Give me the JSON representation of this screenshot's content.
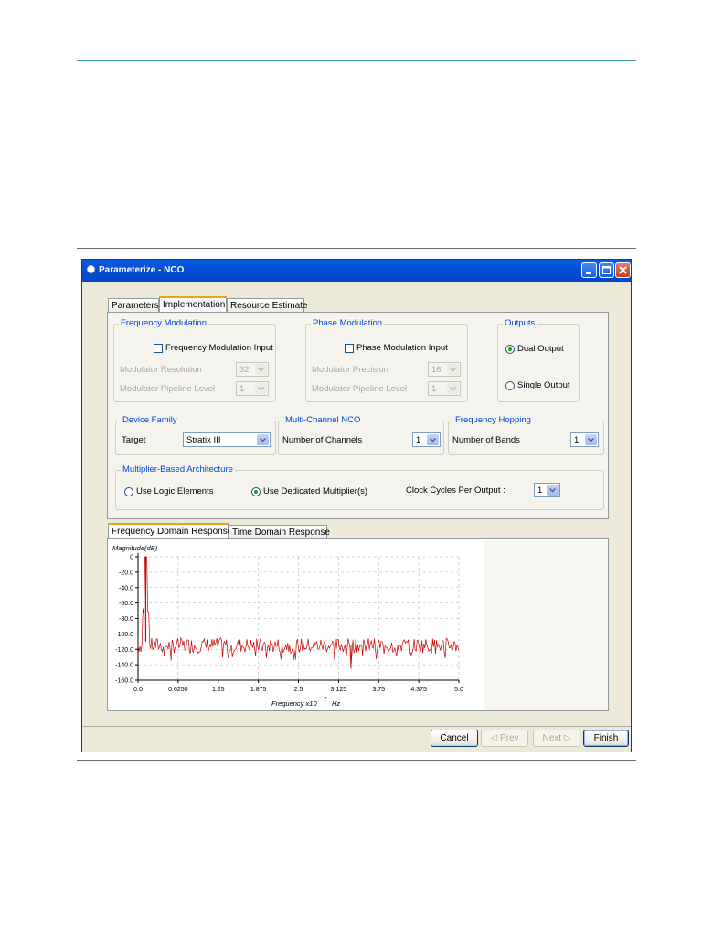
{
  "window": {
    "title": "Parameterize - NCO"
  },
  "tabs": {
    "parameters": "Parameters",
    "implementation": "Implementation",
    "resource": "Resource Estimate"
  },
  "freq_mod": {
    "legend": "Frequency Modulation",
    "input_label": "Frequency Modulation Input",
    "resolution_label": "Modulator Resolution",
    "resolution_value": "32",
    "pipeline_label": "Modulator Pipeline Level",
    "pipeline_value": "1"
  },
  "phase_mod": {
    "legend": "Phase Modulation",
    "input_label": "Phase Modulation Input",
    "precision_label": "Modulator Precision",
    "precision_value": "16",
    "pipeline_label": "Modulator Pipeline Level",
    "pipeline_value": "1"
  },
  "outputs": {
    "legend": "Outputs",
    "dual": "Dual Output",
    "single": "Single Output",
    "selected": "dual"
  },
  "device": {
    "legend": "Device Family",
    "target_label": "Target",
    "target_value": "Stratix III"
  },
  "multichannel": {
    "legend": "Multi-Channel NCO",
    "label": "Number of Channels",
    "value": "1"
  },
  "hopping": {
    "legend": "Frequency Hopping",
    "label": "Number of Bands",
    "value": "1"
  },
  "multiplier": {
    "legend": "Multiplier-Based Architecture",
    "logic": "Use Logic Elements",
    "dedicated": "Use Dedicated Multiplier(s)",
    "selected": "dedicated",
    "clock_label": "Clock Cycles Per Output :",
    "clock_value": "1"
  },
  "response_tabs": {
    "freq": "Frequency Domain Response",
    "time": "Time Domain Response"
  },
  "buttons": {
    "cancel": "Cancel",
    "prev": "◁ Prev",
    "next": "Next ▷",
    "finish": "Finish"
  },
  "chart_data": {
    "type": "line",
    "ylabel": "Magnitude(dB)",
    "xlabel": "Frequency x10",
    "xlabel_exp": "7",
    "xlabel_unit": "Hz",
    "xlim": [
      0,
      5.0
    ],
    "ylim": [
      -160,
      0
    ],
    "x_ticks": [
      "0.0",
      "0.6250",
      "1.25",
      "1.875",
      "2.5",
      "3.125",
      "3.75",
      "4.375",
      "5.0"
    ],
    "y_ticks": [
      "0",
      "-20.0",
      "-40.0",
      "-60.0",
      "-80.0",
      "-100.0",
      "-120.0",
      "-140.0",
      "-160.0"
    ],
    "grid": true,
    "series": [
      {
        "color": "#cc0000",
        "peak": {
          "x": 0.12,
          "y": 0
        },
        "noise_floor_db": [
          -125,
          -105
        ],
        "spur": {
          "x": 3.32,
          "y": -145
        }
      }
    ]
  }
}
